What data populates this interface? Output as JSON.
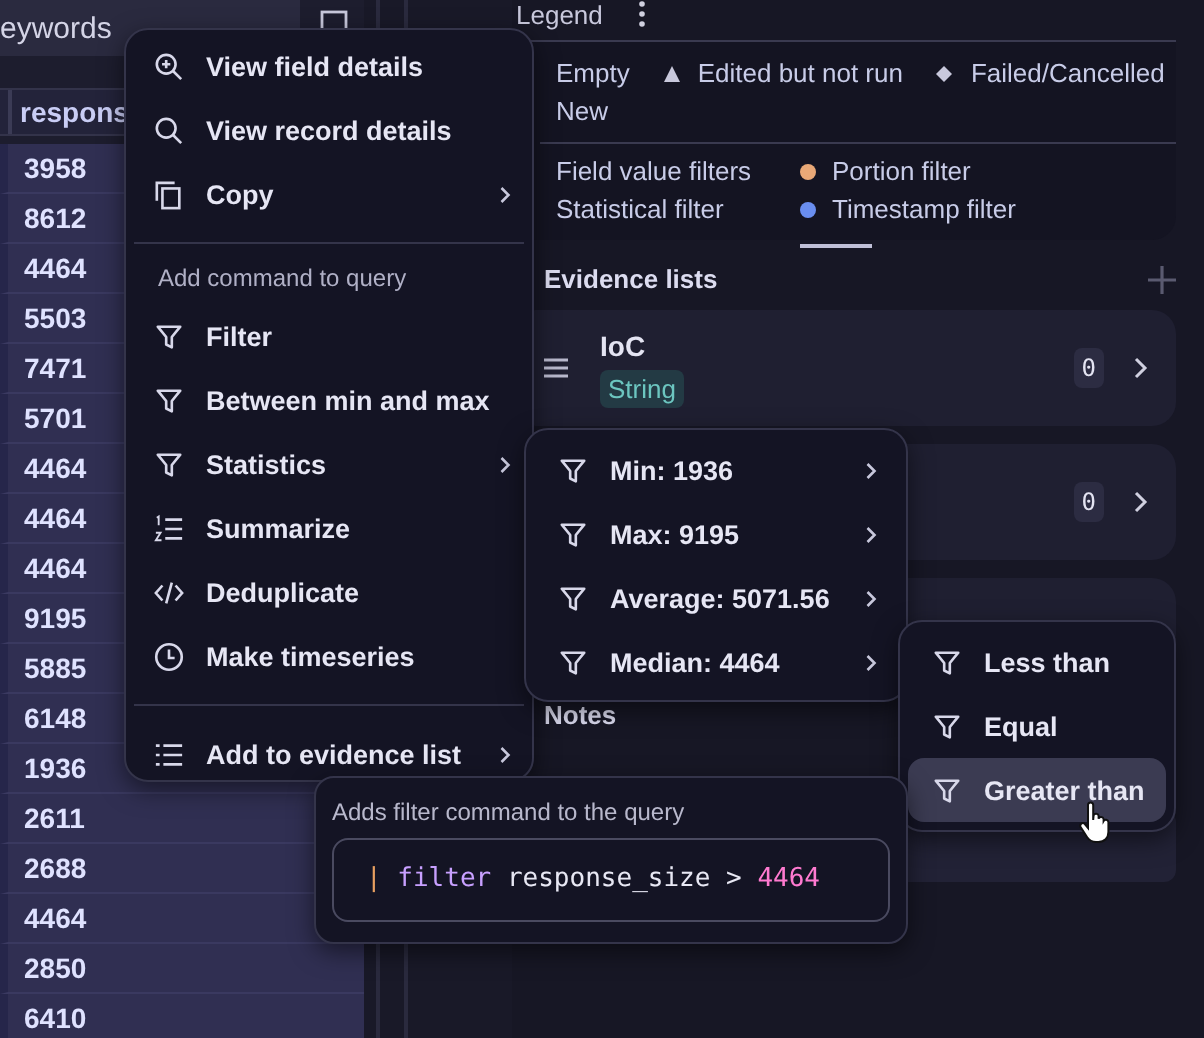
{
  "search": {
    "value": "eywords"
  },
  "table": {
    "columns": [
      "respons"
    ],
    "rows": [
      "3958",
      "8612",
      "4464",
      "5503",
      "7471",
      "5701",
      "4464",
      "4464",
      "4464",
      "9195",
      "5885",
      "6148",
      "1936",
      "2611",
      "2688",
      "4464",
      "2850",
      "6410"
    ]
  },
  "legend": {
    "title": "Legend",
    "status_items": [
      {
        "label": "Empty",
        "kind": "none"
      },
      {
        "label": "Edited but not run",
        "kind": "triangle"
      },
      {
        "label": "Failed/Cancelled",
        "kind": "diamond"
      },
      {
        "label": "New",
        "kind": "none"
      }
    ],
    "filter_items": [
      {
        "label": "Field value filters"
      },
      {
        "label": "Portion filter",
        "color": "#e9a877"
      },
      {
        "label": "Statistical filter"
      },
      {
        "label": "Timestamp filter",
        "color": "#6a8ef0"
      }
    ]
  },
  "evidence_lists": {
    "title": "Evidence lists",
    "items": [
      {
        "name": "IoC",
        "type": "String",
        "count": "0"
      },
      {
        "count": "0"
      }
    ]
  },
  "notes": {
    "title": "Notes"
  },
  "context_menu": {
    "sections": [
      {
        "items": [
          {
            "label": "View field details",
            "submenu": false
          },
          {
            "label": "View record details",
            "submenu": false
          },
          {
            "label": "Copy",
            "submenu": true
          }
        ]
      },
      {
        "heading": "Add command to query",
        "items": [
          {
            "label": "Filter",
            "submenu": false
          },
          {
            "label": "Between min and max",
            "submenu": false
          },
          {
            "label": "Statistics",
            "submenu": true
          },
          {
            "label": "Summarize",
            "submenu": false
          },
          {
            "label": "Deduplicate",
            "submenu": false
          },
          {
            "label": "Make timeseries",
            "submenu": false
          }
        ]
      },
      {
        "items": [
          {
            "label": "Add to evidence list",
            "submenu": true
          }
        ]
      }
    ]
  },
  "statistics_menu": {
    "items": [
      {
        "label": "Min: 1936",
        "submenu": true
      },
      {
        "label": "Max: 9195",
        "submenu": true
      },
      {
        "label": "Average: 5071.56",
        "submenu": true
      },
      {
        "label": "Median: 4464",
        "submenu": true
      }
    ]
  },
  "comparison_menu": {
    "items": [
      {
        "label": "Less than",
        "selected": false
      },
      {
        "label": "Equal",
        "selected": false
      },
      {
        "label": "Greater than",
        "selected": true
      }
    ]
  },
  "tooltip": {
    "text": "Adds filter command to the query",
    "code": {
      "pipe": "|",
      "command": "filter",
      "field": "response_size",
      "operator": ">",
      "value": "4464"
    }
  }
}
